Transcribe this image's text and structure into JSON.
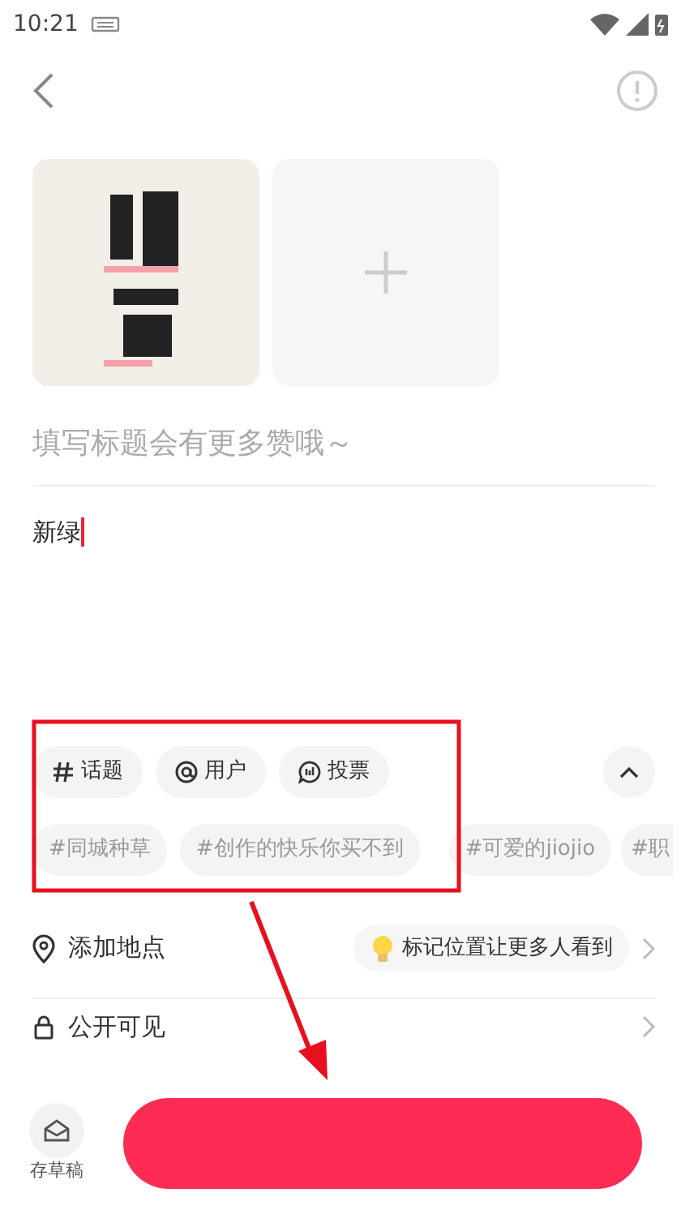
{
  "status_bar": {
    "time": "10:21"
  },
  "images": [
    {
      "kind": "picture"
    },
    {
      "kind": "add"
    }
  ],
  "title_field": {
    "placeholder": "填写标题会有更多赞哦～"
  },
  "body": {
    "value": "新绿"
  },
  "toolbar": [
    {
      "kind": "hash",
      "label": "话题"
    },
    {
      "kind": "at",
      "label": "用户"
    },
    {
      "kind": "vote",
      "label": "投票"
    }
  ],
  "collapse_toggle": {
    "expanded": true
  },
  "topics": [
    "#同城种草",
    "#创作的快乐你买不到",
    "#可爱的jiojio",
    "#职"
  ],
  "location": {
    "label": "添加地点",
    "hint": "标记位置让更多人看到"
  },
  "visibility": {
    "label": "公开可见"
  },
  "bottom_bar": {
    "draft_label": "存草稿"
  },
  "annotation": {
    "highlight": true,
    "arrow": true
  }
}
